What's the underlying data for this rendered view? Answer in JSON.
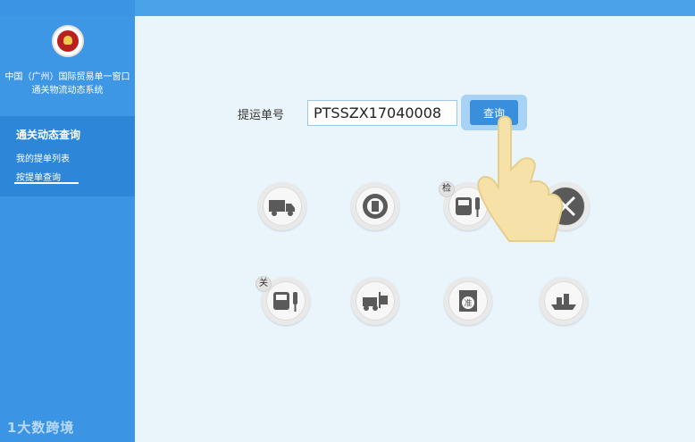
{
  "sidebar": {
    "title_line1": "中国（广州）国际贸易单一窗口",
    "title_line2": "通关物流动态系统",
    "menu_title": "通关动态查询",
    "items": [
      {
        "label": "我的提单列表"
      },
      {
        "label": "按提单查询"
      }
    ],
    "brand": "1大数跨境"
  },
  "query": {
    "label": "提运单号",
    "waybill_value": "PTSSZX17040008",
    "button_label": "查询"
  },
  "status_nodes": [
    {
      "icon": "truck-icon"
    },
    {
      "icon": "customs-emblem-icon"
    },
    {
      "icon": "bus-traffic-light-icon",
      "badge": "检"
    },
    {
      "icon": "tools-crossed-icon"
    },
    {
      "icon": "bus-traffic-light-icon",
      "badge": "关"
    },
    {
      "icon": "forklift-icon"
    },
    {
      "icon": "stamp-approved-icon",
      "stamp_text": "准"
    },
    {
      "icon": "cargo-ship-icon"
    }
  ],
  "colors": {
    "sidebar": "#3b95e4",
    "menu_active": "#2d86d7",
    "topbar": "#4aa3e8",
    "main_bg": "#eaf5fb",
    "button": "#3a8fdd",
    "icon_gray": "#5a5a5a"
  }
}
